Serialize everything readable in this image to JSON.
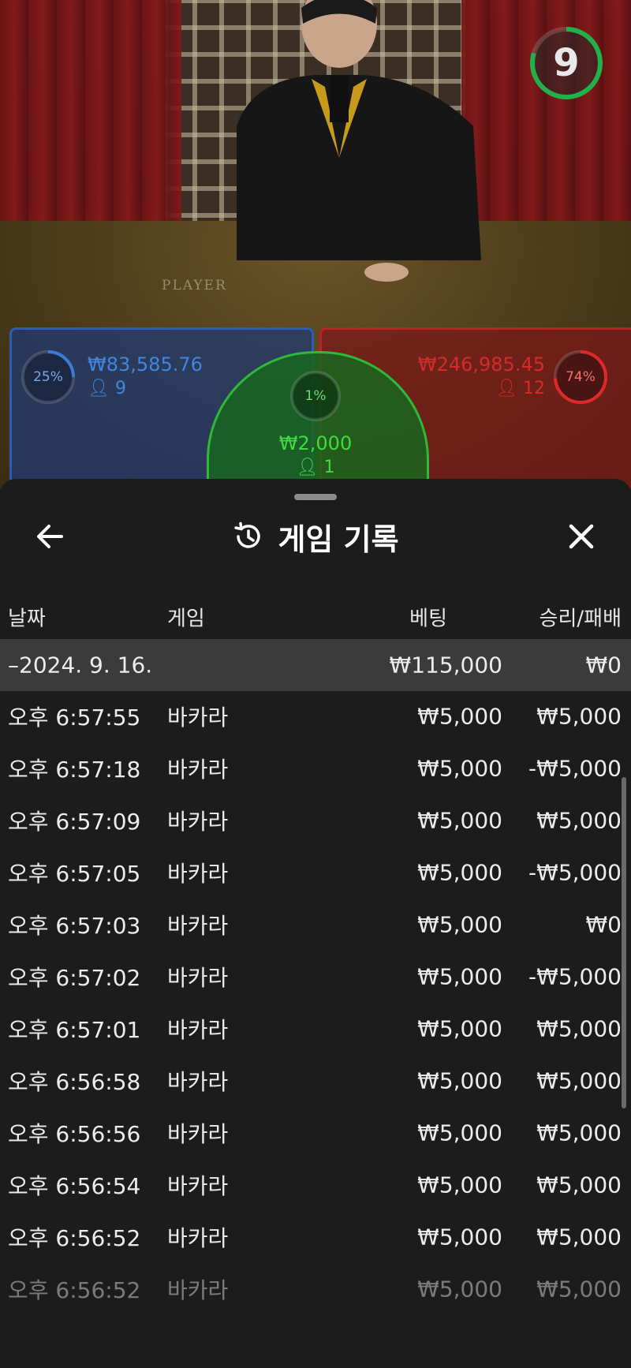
{
  "game": {
    "timer": "9",
    "table_label": "PLAYER",
    "player": {
      "percent": "25%",
      "amount": "₩83,585.76",
      "count": "9"
    },
    "banker": {
      "percent": "74%",
      "amount": "₩246,985.45",
      "count": "12"
    },
    "tie": {
      "percent": "1%",
      "amount": "₩2,000",
      "count": "1"
    }
  },
  "sheet": {
    "title": "게임 기록",
    "columns": {
      "date": "날짜",
      "game": "게임",
      "bet": "베팅",
      "win_loss": "승리/패배"
    },
    "date_group": {
      "date": "–2024. 9. 16.",
      "bet": "₩115,000",
      "win_loss": "₩0"
    },
    "rows": [
      {
        "time": "오후 6:57:55",
        "game": "바카라",
        "bet": "₩5,000",
        "win_loss": "₩5,000"
      },
      {
        "time": "오후 6:57:18",
        "game": "바카라",
        "bet": "₩5,000",
        "win_loss": "-₩5,000"
      },
      {
        "time": "오후 6:57:09",
        "game": "바카라",
        "bet": "₩5,000",
        "win_loss": "₩5,000"
      },
      {
        "time": "오후 6:57:05",
        "game": "바카라",
        "bet": "₩5,000",
        "win_loss": "-₩5,000"
      },
      {
        "time": "오후 6:57:03",
        "game": "바카라",
        "bet": "₩5,000",
        "win_loss": "₩0"
      },
      {
        "time": "오후 6:57:02",
        "game": "바카라",
        "bet": "₩5,000",
        "win_loss": "-₩5,000"
      },
      {
        "time": "오후 6:57:01",
        "game": "바카라",
        "bet": "₩5,000",
        "win_loss": "₩5,000"
      },
      {
        "time": "오후 6:56:58",
        "game": "바카라",
        "bet": "₩5,000",
        "win_loss": "₩5,000"
      },
      {
        "time": "오후 6:56:56",
        "game": "바카라",
        "bet": "₩5,000",
        "win_loss": "₩5,000"
      },
      {
        "time": "오후 6:56:54",
        "game": "바카라",
        "bet": "₩5,000",
        "win_loss": "₩5,000"
      },
      {
        "time": "오후 6:56:52",
        "game": "바카라",
        "bet": "₩5,000",
        "win_loss": "₩5,000"
      },
      {
        "time": "오후 6:56:52",
        "game": "바카라",
        "bet": "₩5,000",
        "win_loss": "₩5,000"
      }
    ]
  },
  "colors": {
    "player": "#2a5cb8",
    "banker": "#c02222",
    "tie": "#2fb83a",
    "timer_ring": "#22b04a"
  }
}
